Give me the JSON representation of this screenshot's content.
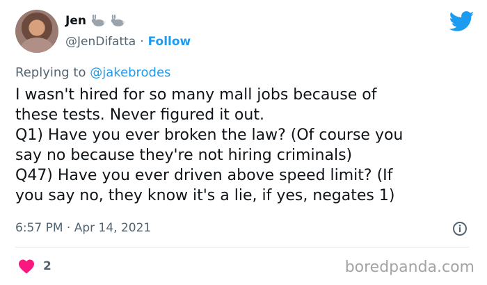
{
  "author": {
    "name": "Jen",
    "handle": "@JenDifatta",
    "separator": "·",
    "follow_label": "Follow",
    "name_emoji_icons": [
      "rabbit-icon",
      "rabbit-icon"
    ]
  },
  "reply": {
    "prefix": "Replying to",
    "mention": "@jakebrodes"
  },
  "tweet": {
    "text": "I wasn't hired for so many mall jobs because of\nthese tests. Never figured it out.\nQ1) Have you ever broken the law? (Of course you\nsay no because they're not hiring criminals)\nQ47) Have you ever driven above speed limit? (If\nyou say no, they know it's a lie, if yes, negates 1)",
    "timestamp": "6:57 PM · Apr 14, 2021"
  },
  "engagement": {
    "likes": "2"
  },
  "watermark": "boredpanda.com",
  "colors": {
    "accent": "#1d9bf0",
    "heart": "#f91880",
    "muted": "#536471"
  }
}
